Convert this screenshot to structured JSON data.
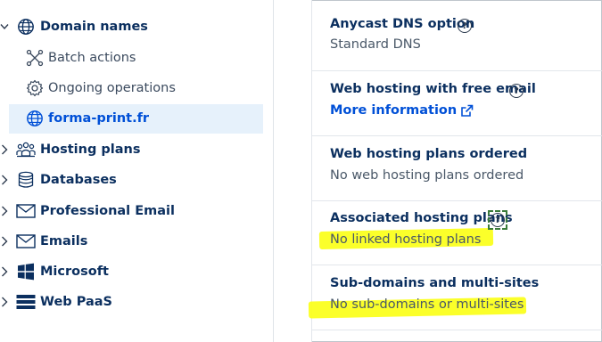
{
  "sidebar": {
    "domain_names": "Domain names",
    "batch_actions": "Batch actions",
    "ongoing_operations": "Ongoing operations",
    "selected_domain": "forma-print.fr",
    "hosting_plans": "Hosting plans",
    "databases": "Databases",
    "professional_email": "Professional Email",
    "emails": "Emails",
    "microsoft": "Microsoft",
    "web_paas": "Web PaaS"
  },
  "details": {
    "anycast_title": "Anycast DNS option",
    "anycast_value": "Standard DNS",
    "webhosting_email_title": "Web hosting with free email",
    "more_info_link": "More information",
    "plans_ordered_title": "Web hosting plans ordered",
    "plans_ordered_value": "No web hosting plans ordered",
    "associated_title": "Associated hosting plans",
    "associated_value": "No linked hosting plans",
    "subdomains_title": "Sub-domains and multi-sites",
    "subdomains_value": "No sub-domains or multi-sites",
    "help_glyph": "?"
  },
  "colors": {
    "brand_blue": "#0050d7",
    "dark_navy": "#0b2f5f",
    "selected_bg": "#e6f1fb",
    "highlight": "#fbff1f"
  },
  "icons": [
    "globe-icon",
    "network-icon",
    "gear-icon",
    "team-icon",
    "database-icon",
    "mail-icon",
    "windows-icon",
    "layers-icon",
    "help-icon",
    "external-link-icon",
    "chevron-icon"
  ]
}
